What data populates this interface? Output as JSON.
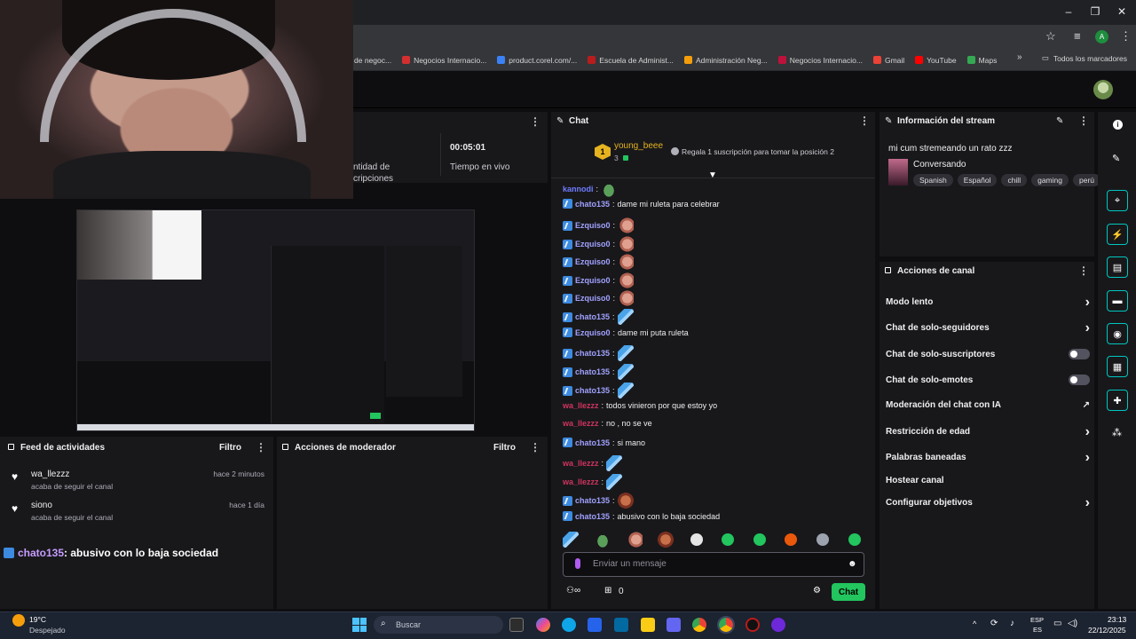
{
  "bookmarks": {
    "items": [
      {
        "label": "de negoc...",
        "color": "#e5e7eb"
      },
      {
        "label": "Negocios Internacio...",
        "color": "#d32f2f"
      },
      {
        "label": "product.corel.com/...",
        "color": "#3b82f6"
      },
      {
        "label": "Escuela de Administ...",
        "color": "#b91c1c"
      },
      {
        "label": "Administración Neg...",
        "color": "#f59e0b"
      },
      {
        "label": "Negocios Internacio...",
        "color": "#be123c"
      },
      {
        "label": "Gmail",
        "color": "#ea4335"
      },
      {
        "label": "YouTube",
        "color": "#ff0000"
      },
      {
        "label": "Maps",
        "color": "#34a853"
      }
    ],
    "folder_label": "Todos los marcadores"
  },
  "stats": {
    "time_value": "00:05:01",
    "time_label": "Tiempo en vivo",
    "subs_label_1": "ntidad de",
    "subs_label_2": "cripciones"
  },
  "feed": {
    "title": "Feed de actividades",
    "filter_label": "Filtro",
    "items": [
      {
        "user": "wa_llezzz",
        "time": "hace 2 minutos",
        "text": "acaba de seguir el canal"
      },
      {
        "user": "siono",
        "time": "hace 1 día",
        "text": "acaba de seguir el canal"
      }
    ],
    "overlay_user": "chato135",
    "overlay_msg": " : abusivo con lo baja sociedad"
  },
  "mod": {
    "title": "Acciones de moderador",
    "filter_label": "Filtro"
  },
  "chat": {
    "title": "Chat",
    "top_user": "young_beee",
    "top_rank": "1",
    "top_count": "3",
    "gift_text": "Regala 1 suscripción para tomar la posición 2",
    "input_placeholder": "Enviar un mensaje",
    "points_value": "0",
    "send_label": "Chat",
    "messages": [
      {
        "user": "kannodi",
        "color": "#6f7cff",
        "text": "",
        "emote": "frog",
        "badge": false
      },
      {
        "user": "chato135",
        "color": "#a1a1ff",
        "text": "dame mi ruleta para celebrar",
        "emote": "",
        "badge": true
      },
      {
        "user": "Ezquiso0",
        "color": "#a1a1ff",
        "text": "",
        "emote": "hand",
        "badge": true
      },
      {
        "user": "Ezquiso0",
        "color": "#a1a1ff",
        "text": "",
        "emote": "hand",
        "badge": true
      },
      {
        "user": "Ezquiso0",
        "color": "#a1a1ff",
        "text": "",
        "emote": "hand",
        "badge": true
      },
      {
        "user": "Ezquiso0",
        "color": "#a1a1ff",
        "text": "",
        "emote": "hand",
        "badge": true
      },
      {
        "user": "Ezquiso0",
        "color": "#a1a1ff",
        "text": "",
        "emote": "hand",
        "badge": true
      },
      {
        "user": "chato135",
        "color": "#a1a1ff",
        "text": "",
        "emote": "blue",
        "badge": true
      },
      {
        "user": "Ezquiso0",
        "color": "#a1a1ff",
        "text": "dame mi puta ruleta",
        "emote": "",
        "badge": true
      },
      {
        "user": "chato135",
        "color": "#a1a1ff",
        "text": "",
        "emote": "blue",
        "badge": true
      },
      {
        "user": "chato135",
        "color": "#a1a1ff",
        "text": "",
        "emote": "blue",
        "badge": true
      },
      {
        "user": "chato135",
        "color": "#a1a1ff",
        "text": "",
        "emote": "blue",
        "badge": true
      },
      {
        "user": "wa_llezzz",
        "color": "#d0345f",
        "text": "todos vinieron por que estoy yo",
        "emote": "",
        "badge": false
      },
      {
        "user": "wa_llezzz",
        "color": "#d0345f",
        "text": "no , no se ve",
        "emote": "",
        "badge": false
      },
      {
        "user": "chato135",
        "color": "#a1a1ff",
        "text": "si mano",
        "emote": "",
        "badge": true
      },
      {
        "user": "wa_llezzz",
        "color": "#d0345f",
        "text": "",
        "emote": "blue",
        "badge": false
      },
      {
        "user": "wa_llezzz",
        "color": "#d0345f",
        "text": "",
        "emote": "blue",
        "badge": false
      },
      {
        "user": "chato135",
        "color": "#a1a1ff",
        "text": "",
        "emote": "face",
        "badge": true
      },
      {
        "user": "chato135",
        "color": "#a1a1ff",
        "text": "abusivo con lo baja sociedad",
        "emote": "",
        "badge": true
      }
    ]
  },
  "info": {
    "title": "Información del stream",
    "stream_title": "mi cum stremeando un rato zzz",
    "category": "Conversando",
    "tags": [
      "Spanish",
      "Español",
      "chill",
      "gaming",
      "perú"
    ]
  },
  "actions": {
    "title": "Acciones de canal",
    "rows": [
      {
        "label": "Modo lento",
        "control": "chevron"
      },
      {
        "label": "Chat de solo-seguidores",
        "control": "chevron"
      },
      {
        "label": "Chat de solo-suscriptores",
        "control": "toggle"
      },
      {
        "label": "Chat de solo-emotes",
        "control": "toggle"
      },
      {
        "label": "Moderación del chat con IA",
        "control": "external"
      },
      {
        "label": "Restricción de edad",
        "control": "chevron"
      },
      {
        "label": "Palabras baneadas",
        "control": "chevron"
      },
      {
        "label": "Hostear canal",
        "control": "none"
      },
      {
        "label": "Configurar objetivos",
        "control": "chevron"
      }
    ]
  },
  "taskbar": {
    "weather_temp": "19°C",
    "weather_desc": "Despejado",
    "search_placeholder": "Buscar",
    "lang_1": "ESP",
    "lang_2": "ES",
    "time": "23:13",
    "date": "22/12/2025"
  }
}
